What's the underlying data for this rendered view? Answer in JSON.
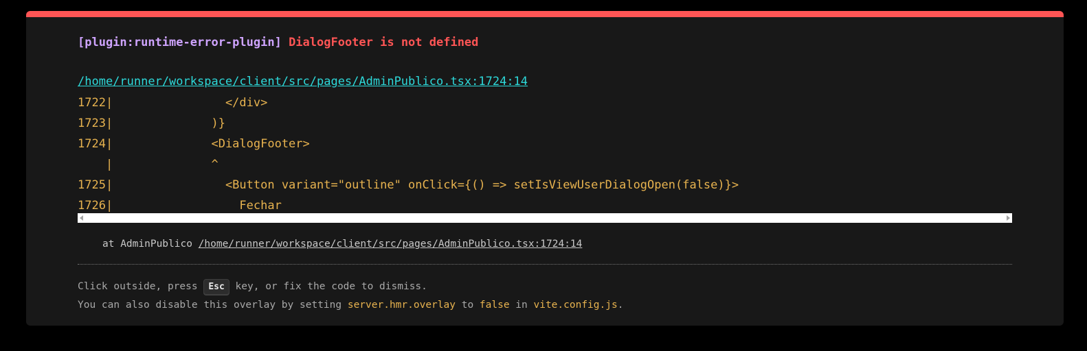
{
  "error": {
    "plugin_label": "[plugin:runtime-error-plugin]",
    "message": "DialogFooter is not defined",
    "file": "/home/runner/workspace/client/src/pages/AdminPublico.tsx:1724:14"
  },
  "frame": [
    {
      "gutter": "1722|",
      "code": "                </div>"
    },
    {
      "gutter": "1723|",
      "code": "              )}"
    },
    {
      "gutter": "1724|",
      "code": "              <DialogFooter>"
    },
    {
      "gutter": "    |",
      "code": "              ^"
    },
    {
      "gutter": "1725|",
      "code": "                <Button variant=\"outline\" onClick={() => setIsViewUserDialogOpen(false)}>"
    },
    {
      "gutter": "1726|",
      "code": "                  Fechar"
    }
  ],
  "stack": {
    "prefix": "at AdminPublico ",
    "link": "/home/runner/workspace/client/src/pages/AdminPublico.tsx:1724:14"
  },
  "tips": {
    "line1_before": "Click outside, press ",
    "line1_key": "Esc",
    "line1_after": " key, or fix the code to dismiss.",
    "line2_before": "You can also disable this overlay by setting ",
    "line2_code1": "server.hmr.overlay",
    "line2_mid1": " to ",
    "line2_code2": "false",
    "line2_mid2": " in ",
    "line2_code3": "vite.config.js",
    "line2_end": "."
  },
  "colors": {
    "accent_border": "#ff5555",
    "plugin": "#cfa4ff",
    "message": "#ff5555",
    "file_link": "#2dd9da",
    "code": "#e8b34f",
    "background": "#181818"
  }
}
